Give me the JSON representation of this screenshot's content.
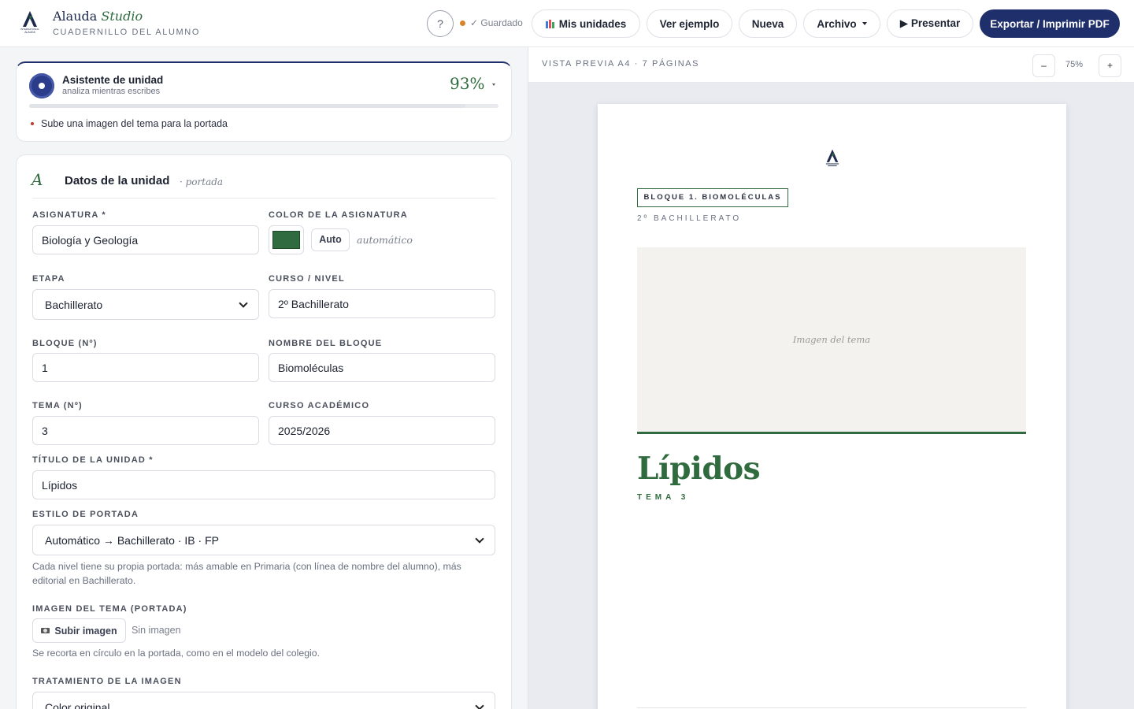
{
  "brand": {
    "name": "Alauda",
    "name_italic": "Studio",
    "subtitle": "CUADERNILLO DEL ALUMNO",
    "logo_lines": [
      "INTERNATIONAL",
      "ALAUDA"
    ]
  },
  "topbar": {
    "help_label": "?",
    "saved_text": "✓ Guardado",
    "buttons": {
      "mis_unidades": "Mis unidades",
      "ver_ejemplo": "Ver ejemplo",
      "nueva": "Nueva",
      "archivo": "Archivo",
      "presentar": "▶ Presentar",
      "exportar": "Exportar / Imprimir PDF"
    }
  },
  "assistant": {
    "title": "Asistente de unidad",
    "subtitle": "analiza mientras escribes",
    "score": "93%",
    "progress": 0.93,
    "tip": "Sube una imagen del tema para la portada"
  },
  "datos": {
    "icon": "A",
    "title": "Datos de la unidad",
    "note": "· portada",
    "fields": {
      "asignatura": {
        "label": "ASIGNATURA *",
        "value": "Biología y Geología"
      },
      "color": {
        "label": "COLOR DE LA ASIGNATURA",
        "value": "#2f6b3e",
        "auto_label": "Auto",
        "note": "automático"
      },
      "etapa": {
        "label": "ETAPA",
        "value": "Bachillerato"
      },
      "curso": {
        "label": "CURSO / NIVEL",
        "value": "2º Bachillerato"
      },
      "bloque_num": {
        "label": "BLOQUE (Nº)",
        "value": "1"
      },
      "bloque_nombre": {
        "label": "NOMBRE DEL BLOQUE",
        "value": "Biomoléculas"
      },
      "tema_num": {
        "label": "TEMA (Nº)",
        "value": "3"
      },
      "curso_academico": {
        "label": "CURSO ACADÉMICO",
        "value": "2025/2026"
      },
      "titulo": {
        "label": "TÍTULO DE LA UNIDAD *",
        "value": "Lípidos"
      },
      "estilo": {
        "label": "ESTILO DE PORTADA",
        "value": "Automático → Bachillerato · IB · FP",
        "help": "Cada nivel tiene su propia portada: más amable en Primaria (con línea de nombre del alumno), más editorial en Bachillerato."
      },
      "imagen": {
        "label": "IMAGEN DEL TEMA (PORTADA)",
        "button": "Subir imagen",
        "status": "Sin imagen",
        "help": "Se recorta en círculo en la portada, como en el modelo del colegio."
      },
      "tratamiento": {
        "label": "TRATAMIENTO DE LA IMAGEN",
        "value": "Color original"
      }
    }
  },
  "preview": {
    "label": "VISTA PREVIA A4 · 7 PÁGINAS",
    "zoom_out": "–",
    "zoom_value": "75%",
    "zoom_in": "+",
    "page": {
      "block_tag": "BLOQUE 1. BIOMOLÉCULAS",
      "course_tag": "2º BACHILLERATO",
      "image_placeholder": "Imagen del tema",
      "title": "Lípidos",
      "tema": "TEMA 3"
    }
  },
  "colors": {
    "accent": "#2f6b3e",
    "navy": "#1f2f6b",
    "saved_dot": "#d9822b",
    "tip_dot": "#c0392b"
  }
}
